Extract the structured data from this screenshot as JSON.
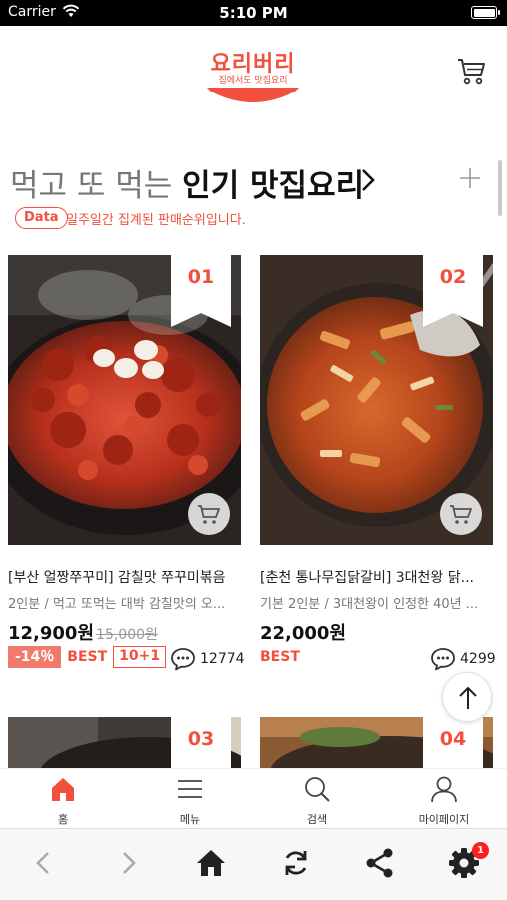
{
  "status_bar": {
    "carrier": "Carrier",
    "time": "5:10 PM"
  },
  "header": {
    "logo_name": "요리버리",
    "logo_tagline": "집에서도 맛집요리"
  },
  "section": {
    "title_light": "먹고 또 먹는",
    "title_bold": "인기 맛집요리",
    "data_badge": "Data",
    "subtitle": "일주일간 집계된 판매순위입니다."
  },
  "products": [
    {
      "rank": "01",
      "title": "[부산 얼짱쭈꾸미] 감칠맛 쭈꾸미볶음",
      "desc": "2인분 / 먹고 또먹는 대박 감칠맛의 오...",
      "price": "12,900원",
      "old_price": "15,000원",
      "discount": "-14％",
      "best": "BEST",
      "promo": "10+1",
      "reviews": "12774"
    },
    {
      "rank": "02",
      "title": "[춘천 통나무집닭갈비] 3대천왕 닭...",
      "desc": "기본 2인분 / 3대천왕이 인정한 40년 ...",
      "price": "22,000원",
      "best": "BEST",
      "reviews": "4299"
    },
    {
      "rank": "03"
    },
    {
      "rank": "04"
    }
  ],
  "tabbar": {
    "home": "홈",
    "menu": "메뉴",
    "search": "검색",
    "mypage": "마이페이지"
  },
  "toolbar": {
    "settings_badge": "1"
  },
  "colors": {
    "accent": "#f0503c",
    "discount_bg": "#f07b6d",
    "badge_red": "#ff1e1e"
  },
  "icons": [
    "wifi-icon",
    "cart-icon",
    "chevron-right-icon",
    "plus-icon",
    "comment-icon",
    "arrow-up-icon",
    "home-icon",
    "hamburger-icon",
    "search-icon",
    "person-icon",
    "back-icon",
    "forward-icon",
    "refresh-icon",
    "share-icon",
    "gear-icon"
  ]
}
